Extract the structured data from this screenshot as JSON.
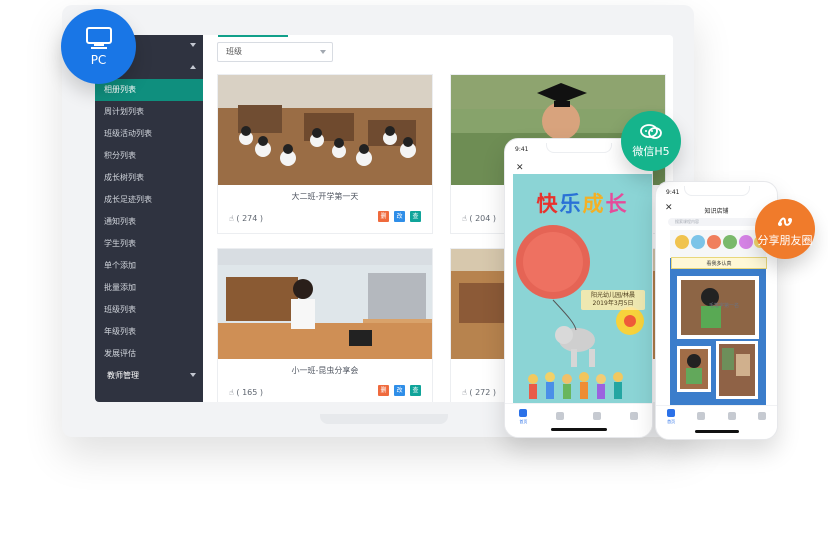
{
  "sidebar": {
    "group_partial": "理",
    "items": [
      "相册列表",
      "周计划列表",
      "班级活动列表",
      "积分列表",
      "成长树列表",
      "成长足迹列表",
      "通知列表",
      "学生列表",
      "单个添加",
      "批量添加",
      "班级列表",
      "年级列表",
      "发展评估"
    ],
    "footer_group": "教师管理"
  },
  "filter": {
    "class_select": "班级"
  },
  "albums": [
    {
      "title": "大二班-开学第一天",
      "likes": "( 274 )"
    },
    {
      "title": "",
      "likes": "( 204 )"
    },
    {
      "title": "小一班-昆虫分享会",
      "likes": "( 165 )"
    },
    {
      "title": "",
      "likes": "( 272 )"
    }
  ],
  "actions": {
    "delete": "删",
    "edit": "改",
    "view": "查"
  },
  "badges": {
    "pc": "PC",
    "wechat": "微信H5",
    "share": "分享朋友圈"
  },
  "phone_h5": {
    "time": "9:41",
    "title_1": "快",
    "title_2": "乐",
    "title_3": "成",
    "title_4": "长",
    "subtitle_line1": "阳光幼儿园/林晨",
    "subtitle_line2": "2019年3月5日",
    "tab_home": "首页"
  },
  "phone_share": {
    "time": "9:41",
    "title": "知识店铺",
    "search_placeholder": "搜索课程内容",
    "banner": "看我多认真",
    "small_caption": "毛笔字第一名",
    "tab_home": "首页"
  },
  "colors": {
    "sidebar_bg": "#2f3340",
    "sidebar_active": "#0f8f7e",
    "pc_badge": "#1976e6",
    "wechat_badge": "#15b48c",
    "share_badge": "#f07b2b"
  }
}
